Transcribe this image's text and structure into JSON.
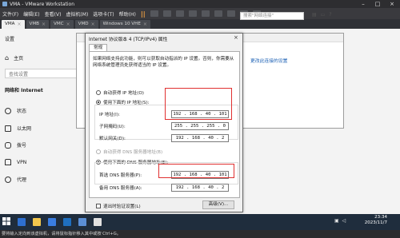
{
  "vmware": {
    "title": "VMA - VMware Workstation",
    "menu": [
      "文件(F)",
      "编辑(E)",
      "查看(V)",
      "虚拟机(M)",
      "选项卡(T)",
      "帮助(H)"
    ],
    "tabs": [
      {
        "label": "VMA",
        "active": true
      },
      {
        "label": "VMB",
        "active": false
      },
      {
        "label": "VMC",
        "active": false
      },
      {
        "label": "VMD",
        "active": false
      },
      {
        "label": "Windows 10 VHE",
        "active": false
      }
    ],
    "statusbar": "要将输入定向到该虚拟机，请将鼠标指针移入其中或按 Ctrl+G。"
  },
  "settings": {
    "title": "设置",
    "home": "主页",
    "search_placeholder": "查找设置",
    "section": "网络和 Internet",
    "nav": [
      "状态",
      "以太网",
      "拨号",
      "VPN",
      "代理"
    ]
  },
  "network_window": {
    "search_label": "更改此连接的设置",
    "search_placeholder": "搜索\"网络连接\"",
    "link_text": "更改此连接的设置"
  },
  "dialog": {
    "title": "Internet 协议版本 4 (TCP/IPv4) 属性",
    "close": "×",
    "tab": "常规",
    "description": "如果网络支持此功能，则可以获取自动指派的 IP 设置。否则，你需要从网络系统管理员处获得适当的 IP 设置。",
    "auto_ip": "自动获得 IP 地址(O)",
    "manual_ip": "使用下面的 IP 地址(S):",
    "ip_label": "IP 地址(I):",
    "ip_value": "192 . 168 . 40 . 101",
    "mask_label": "子网掩码(U):",
    "mask_value": "255 . 255 . 255 . 0",
    "gateway_label": "默认网关(D):",
    "gateway_value": "192 . 168 . 40 . 2",
    "auto_dns": "自动获得 DNS 服务器地址(B)",
    "manual_dns": "使用下面的 DNS 服务器地址(E):",
    "dns1_label": "首选 DNS 服务器(P):",
    "dns1_value": "192 . 168 . 40 . 101",
    "dns2_label": "备用 DNS 服务器(A):",
    "dns2_value": "192 . 168 . 40 . 2",
    "validate": "退出时验证设置(L)",
    "advanced": "高级(V)..."
  },
  "taskbar": {
    "time": "23:34",
    "date": "2023/11/7"
  },
  "colors": {
    "highlight_box": "#e03030",
    "taskbar": "#1f2d3d",
    "vmware_chrome": "#2d2d30"
  }
}
